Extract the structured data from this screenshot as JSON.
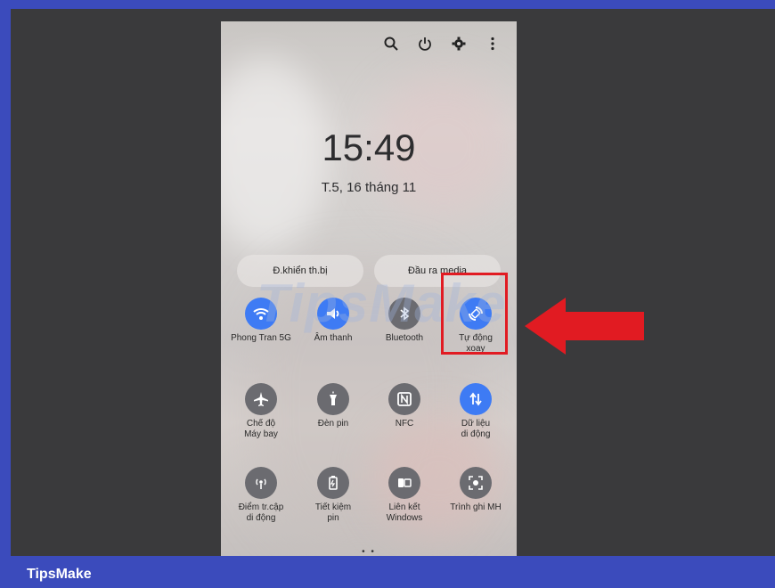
{
  "phone": {
    "clock": "15:49",
    "date": "T.5, 16 tháng 11",
    "pills": {
      "left": "Đ.khiển th.bị",
      "right": "Đầu ra media"
    },
    "tiles": [
      {
        "label": "Phong Tran 5G",
        "icon": "wifi-icon",
        "active": true
      },
      {
        "label": "Âm thanh",
        "icon": "sound-icon",
        "active": true
      },
      {
        "label": "Bluetooth",
        "icon": "bluetooth-icon",
        "active": false
      },
      {
        "label": "Tự động\nxoay",
        "icon": "auto-rotate-icon",
        "active": true
      },
      {
        "label": "Chế độ\nMáy bay",
        "icon": "airplane-icon",
        "active": false
      },
      {
        "label": "Đèn pin",
        "icon": "flashlight-icon",
        "active": false
      },
      {
        "label": "NFC",
        "icon": "nfc-icon",
        "active": false
      },
      {
        "label": "Dữ liệu\ndi động",
        "icon": "mobile-data-icon",
        "active": true
      },
      {
        "label": "Điểm tr.cập\ndi động",
        "icon": "hotspot-icon",
        "active": false
      },
      {
        "label": "Tiết kiệm\npin",
        "icon": "battery-saver-icon",
        "active": false
      },
      {
        "label": "Liên kết\nWindows",
        "icon": "link-windows-icon",
        "active": false
      },
      {
        "label": "Trình ghi MH",
        "icon": "screen-recorder-icon",
        "active": false
      }
    ]
  },
  "watermark": "TipsMake",
  "footer": {
    "brand": "TipsMake"
  },
  "colors": {
    "accent": "#3e7bf4",
    "highlight": "#e11b22",
    "footer_bar": "#3b4bbc"
  }
}
